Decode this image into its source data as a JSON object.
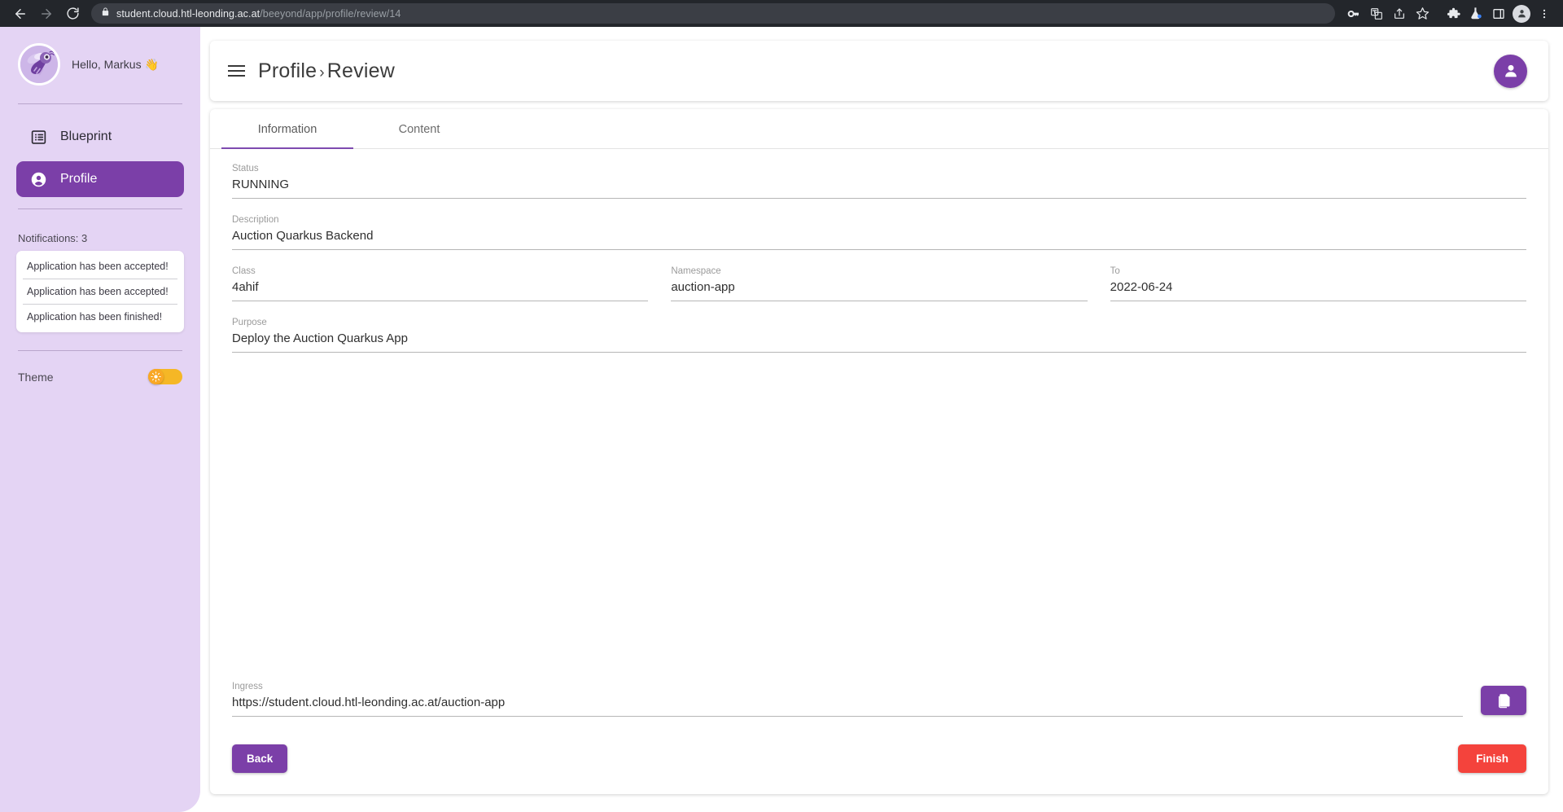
{
  "browser": {
    "back_icon": "arrow-left-icon",
    "forward_icon": "arrow-right-icon",
    "reload_icon": "reload-icon",
    "lock_icon": "lock-icon",
    "url_domain": "student.cloud.htl-leonding.ac.at",
    "url_path": "/beeyond/app/profile/review/14",
    "toolbar_icons": [
      "password-key-icon",
      "translate-icon",
      "share-icon",
      "bookmark-star-icon",
      "extensions-puzzle-icon",
      "labs-flask-icon",
      "side-panel-icon",
      "profile-avatar-icon",
      "three-dot-menu-icon"
    ]
  },
  "sidebar": {
    "avatar_icon": "bee-avatar",
    "greeting": "Hello, Markus 👋",
    "nav_items": [
      {
        "label": "Blueprint",
        "icon": "list-blueprint-icon",
        "active": false
      },
      {
        "label": "Profile",
        "icon": "person-circle-icon",
        "active": true
      }
    ],
    "notifications_title": "Notifications: 3",
    "notifications": [
      "Application has been accepted!",
      "Application has been accepted!",
      "Application has been finished!"
    ],
    "theme_label": "Theme",
    "theme_toggle_icon": "sun-icon",
    "theme_toggle_on": true
  },
  "header": {
    "menu_icon": "hamburger-menu-icon",
    "breadcrumb_root": "Profile",
    "breadcrumb_separator": "›",
    "breadcrumb_current": "Review",
    "account_icon": "person-icon"
  },
  "tabs": [
    {
      "label": "Information",
      "active": true
    },
    {
      "label": "Content",
      "active": false
    }
  ],
  "form": {
    "status": {
      "label": "Status",
      "value": "RUNNING"
    },
    "description": {
      "label": "Description",
      "value": "Auction Quarkus Backend"
    },
    "class": {
      "label": "Class",
      "value": "4ahif"
    },
    "namespace": {
      "label": "Namespace",
      "value": "auction-app"
    },
    "to": {
      "label": "To",
      "value": "2022-06-24"
    },
    "purpose": {
      "label": "Purpose",
      "value": "Deploy the Auction Quarkus App"
    },
    "ingress": {
      "label": "Ingress",
      "value": "https://student.cloud.htl-leonding.ac.at/auction-app"
    },
    "copy_icon": "copy-icon"
  },
  "actions": {
    "back_label": "Back",
    "finish_label": "Finish"
  },
  "colors": {
    "sidebar_bg": "#e4d4f4",
    "primary_purple": "#7b3fa8",
    "tab_accent": "#7e4bb0",
    "danger_red": "#f4433c",
    "toggle_amber": "#f5b726"
  }
}
